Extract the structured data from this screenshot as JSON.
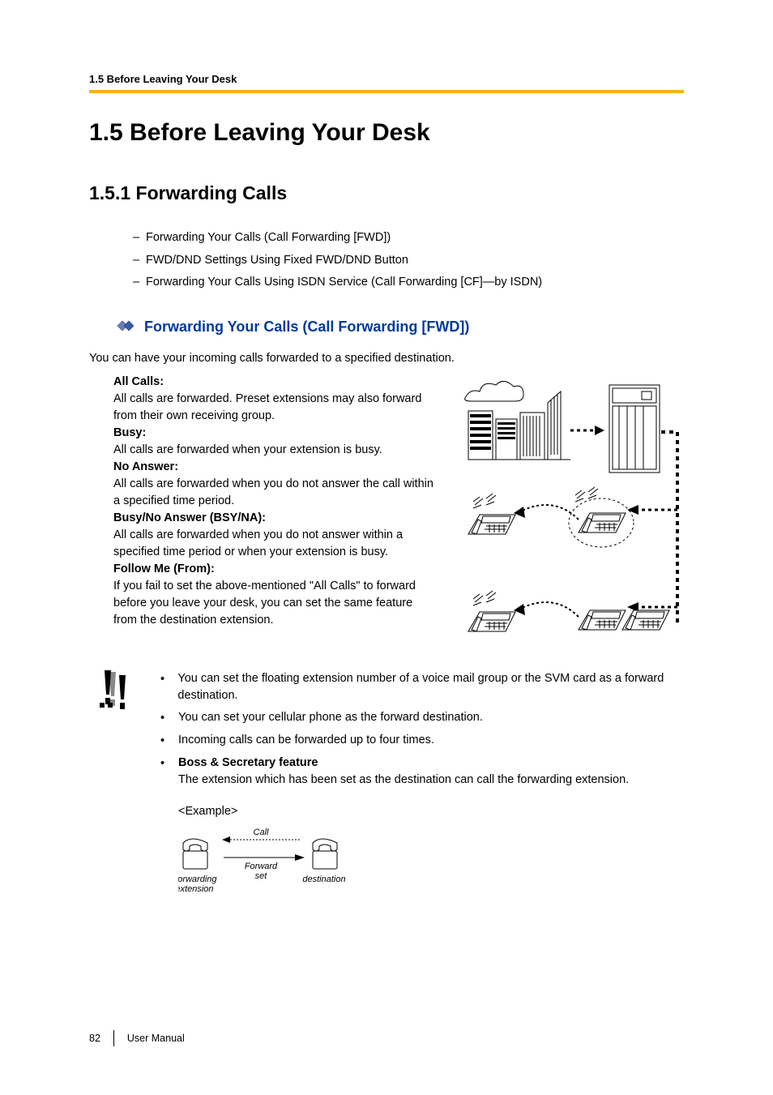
{
  "running_head": "1.5 Before Leaving Your Desk",
  "h1": "1.5    Before Leaving Your Desk",
  "h2": "1.5.1    Forwarding Calls",
  "toc": [
    "Forwarding Your Calls (Call Forwarding [FWD])",
    "FWD/DND Settings Using Fixed FWD/DND Button",
    "Forwarding Your Calls Using ISDN Service (Call Forwarding [CF]—by ISDN)"
  ],
  "h3": "Forwarding Your Calls (Call Forwarding [FWD])",
  "intro": "You can have your incoming calls forwarded to a specified destination.",
  "defs": [
    {
      "term": "All Calls:",
      "body": "All calls are forwarded. Preset extensions may also forward from their own receiving group."
    },
    {
      "term": "Busy:",
      "body": "All calls are forwarded when your extension is busy."
    },
    {
      "term": "No Answer:",
      "body": "All calls are forwarded when you do not answer the call within a specified time period."
    },
    {
      "term": "Busy/No Answer (BSY/NA):",
      "body": "All calls are forwarded when you do not answer within a specified time period or when your extension is busy."
    },
    {
      "term": "Follow Me (From):",
      "body": "If you fail to set the above-mentioned \"All Calls\" to forward before you leave your desk, you can set the same feature from the destination extension."
    }
  ],
  "bullets": {
    "b1": "You can set the floating extension number of a voice mail group or the SVM card as a forward destination.",
    "b2": "You can set your cellular phone as the forward destination.",
    "b3": "Incoming calls can be forwarded up to four times.",
    "b4_term": "Boss & Secretary feature",
    "b4_body": "The extension which has been set as the destination can call the forwarding extension."
  },
  "example_label": "<Example>",
  "diagram": {
    "call": "Call",
    "forward": "Forward",
    "set": "set",
    "fwd_ext_1": "Forwarding",
    "fwd_ext_2": "extension",
    "destination": "destination"
  },
  "footer": {
    "page": "82",
    "doc": "User Manual"
  }
}
